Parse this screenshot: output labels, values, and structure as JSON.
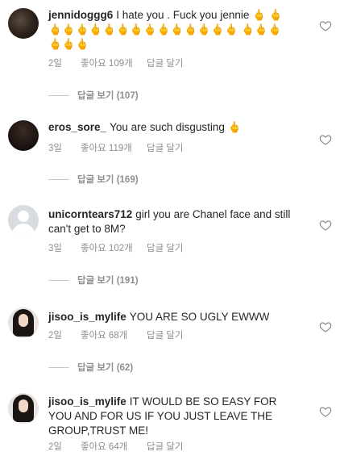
{
  "comments": [
    {
      "username": "jennidoggg6",
      "text": "I hate you . Fuck you  jennie",
      "emojis": "🖕 🖕🖕🖕🖕🖕🖕🖕🖕🖕🖕🖕🖕🖕🖕🖕 🖕🖕🖕🖕🖕🖕",
      "date": "2일",
      "likes": "좋아요 109개",
      "reply": "답글 달기",
      "view_replies": "답글 보기 (107)"
    },
    {
      "username": "eros_sore_",
      "text": "You are such disgusting",
      "emojis": "🖕",
      "date": "3일",
      "likes": "좋아요 119개",
      "reply": "답글 달기",
      "view_replies": "답글 보기 (169)"
    },
    {
      "username": "unicorntears712",
      "text": "girl you are Chanel face and still can't get to 8M?",
      "emojis": "",
      "date": "3일",
      "likes": "좋아요 102개",
      "reply": "답글 달기",
      "view_replies": "답글 보기 (191)"
    },
    {
      "username": "jisoo_is_mylife",
      "text": "YOU ARE SO UGLY EWWW",
      "emojis": "",
      "date": "2일",
      "likes": "좋아요 68개",
      "reply": "답글 달기",
      "view_replies": "답글 보기 (62)"
    },
    {
      "username": "jisoo_is_mylife",
      "text": "IT WOULD BE SO EASY FOR YOU AND FOR US IF YOU JUST LEAVE THE GROUP,TRUST ME!",
      "emojis": "",
      "date": "2일",
      "likes": "좋아요 64개",
      "reply": "답글 달기",
      "view_replies": ""
    }
  ],
  "icons": {
    "like": "heart-outline-icon",
    "avatar_placeholder": "user-silhouette-icon"
  },
  "colors": {
    "meta": "#8e8e8e",
    "text": "#262626",
    "emoji": "#f2b01e"
  }
}
